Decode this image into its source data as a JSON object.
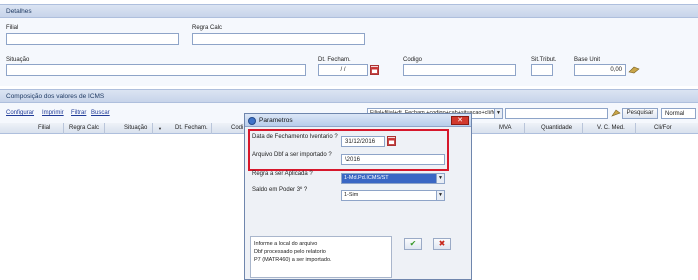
{
  "detalhes": {
    "title": "Detalhes",
    "filial_label": "Filial",
    "regra_label": "Regra Calc",
    "situacao_label": "Situação",
    "dt_fecham_label": "Dt. Fecham.",
    "dt_fecham_value": "/ /",
    "codigo_label": "Codigo",
    "sit_tribut_label": "Sit.Tribut.",
    "base_unit_label": "Base Unit",
    "base_unit_value": "0,00"
  },
  "composicao": {
    "title": "Composição dos valores de ICMS",
    "links": [
      "Configurar",
      "Imprimir",
      "Filtrar",
      "Buscar"
    ],
    "filter_select_value": "Filial+filial+dt. Fecham.+codigo+cab+situacao+cli/for",
    "pesquisar_label": "Pesquisar",
    "normal_value": "Normal",
    "columns_left": [
      "Filial",
      "Regra Calc",
      "Situação",
      "Dt. Fecham.",
      "Codi"
    ],
    "columns_right": [
      "MVA",
      "Quantidade",
      "V. C. Med.",
      "Cli/For"
    ]
  },
  "dialog": {
    "title": "Parametros",
    "data_fechamento_label": "Data de Fechamento Iventario ?",
    "data_fechamento_value": "31/12/2016",
    "arquivo_label": "Arquivo Dbf a ser importado ?",
    "arquivo_value": "\\2016",
    "regra_label": "Regra a ser Aplicada ?",
    "regra_value": "1-Md.Pd.ICMS/ST",
    "saldo_label": "Saldo em Poder 3º ?",
    "saldo_value": "1-Sim",
    "info_lines": [
      "Informe a local do arquivo",
      "Dbf processado pelo relatorio",
      "P7 (MATR460) a ser importado."
    ]
  },
  "colors": {
    "header_bg": "#c7d4ea",
    "highlight_red": "#d6172b",
    "selection_blue": "#3a67c4"
  }
}
